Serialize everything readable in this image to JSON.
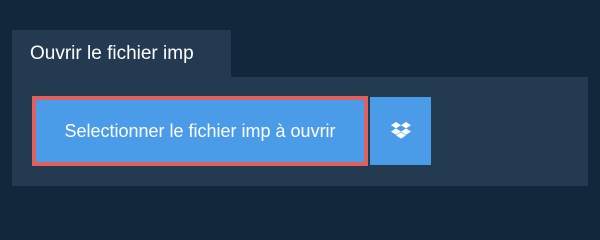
{
  "tab": {
    "label": "Ouvrir le fichier imp"
  },
  "actions": {
    "open_file_label": "Selectionner le fichier imp à ouvrir",
    "dropbox_icon": "dropbox-icon"
  },
  "colors": {
    "background": "#12263c",
    "panel": "#233a51",
    "button": "#4a9be8",
    "focus_outline": "#e0605e",
    "text": "#ffffff"
  }
}
